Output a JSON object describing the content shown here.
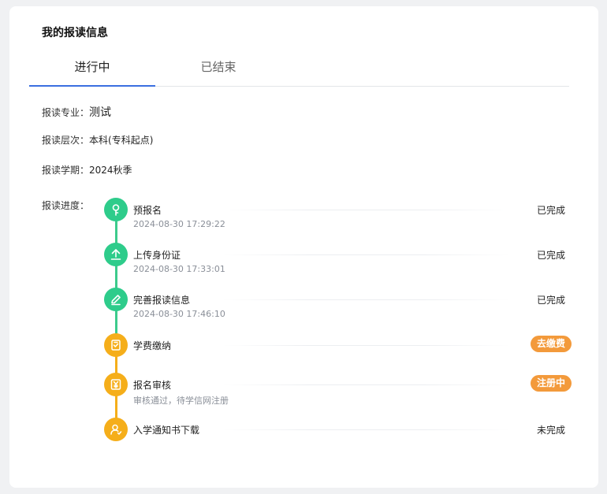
{
  "page_title": "我的报读信息",
  "tabs": [
    {
      "label": "进行中",
      "active": true
    },
    {
      "label": "已结束",
      "active": false
    }
  ],
  "info": {
    "major": {
      "label": "报读专业：",
      "value": "测试"
    },
    "level": {
      "label": "报读层次：",
      "value": "本科(专科起点)"
    },
    "term": {
      "label": "报读学期：",
      "value": "2024秋季"
    },
    "progress_label": "报读进度："
  },
  "steps": [
    {
      "name": "预报名",
      "time": "2024-08-30 17:29:22",
      "status": "已完成",
      "icon": "key-icon",
      "color": "#2ecc8b"
    },
    {
      "name": "上传身份证",
      "time": "2024-08-30 17:33:01",
      "status": "已完成",
      "icon": "upload-icon",
      "color": "#2ecc8b"
    },
    {
      "name": "完善报读信息",
      "time": "2024-08-30 17:46:10",
      "status": "已完成",
      "icon": "edit-icon",
      "color": "#2ecc8b"
    },
    {
      "name": "学费缴纳",
      "time": "",
      "status": "去缴费",
      "icon": "receipt-icon",
      "color": "#f5ae1a"
    },
    {
      "name": "报名审核",
      "time": "审核通过，待学信网注册",
      "status": "注册中",
      "icon": "yuan-doc-icon",
      "color": "#f5ae1a"
    },
    {
      "name": "入学通知书下载",
      "time": "",
      "status": "未完成",
      "icon": "user-icon",
      "color": "#f5ae1a"
    }
  ],
  "colors": {
    "accent": "#3b6fe0",
    "done": "#2ecc8b",
    "pending": "#f5ae1a",
    "action": "#f39a3b"
  }
}
